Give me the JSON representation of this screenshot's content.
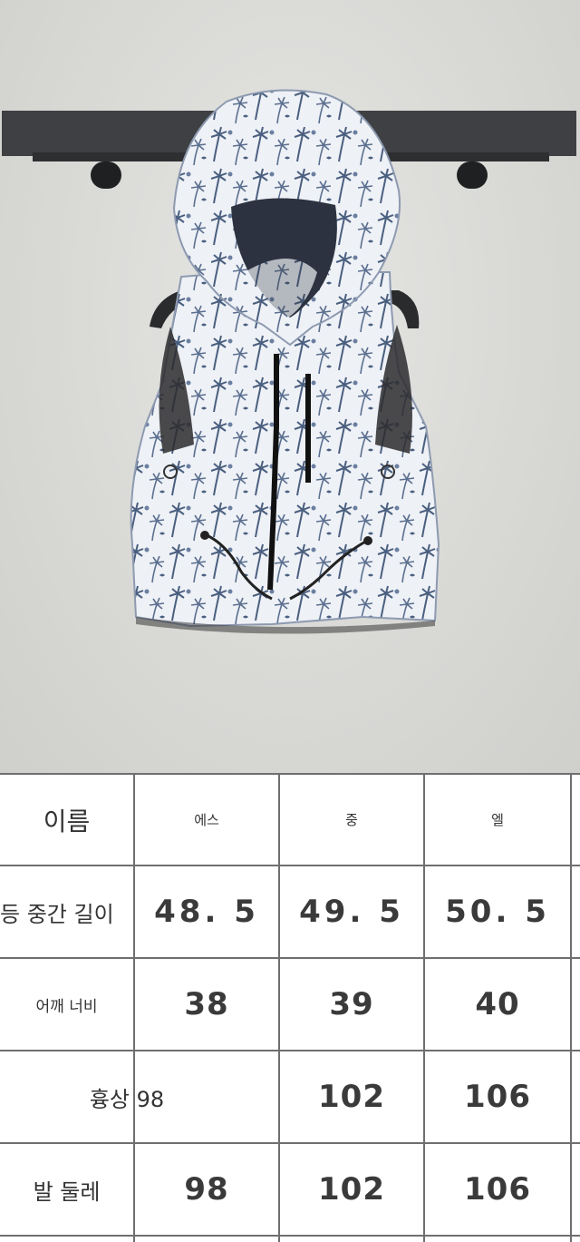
{
  "table": {
    "header": {
      "label": "이름",
      "sizes": [
        "에스",
        "중",
        "엘"
      ]
    },
    "rows": [
      {
        "label": "등 중간 길이",
        "values": [
          "48. 5",
          "49. 5",
          "50. 5"
        ]
      },
      {
        "label": "어깨 너비",
        "values": [
          "38",
          "39",
          "40"
        ]
      },
      {
        "label": "흉상 98",
        "values": [
          "",
          "102",
          "106"
        ]
      },
      {
        "label": "발 둘레",
        "values": [
          "98",
          "102",
          "106"
        ]
      }
    ]
  },
  "colors": {
    "grid": "#6f6f6f",
    "text": "#333333",
    "print": "#4a5f7f",
    "wall": "#d9d9d6"
  },
  "photo": {
    "subject": "hooded-vest-photo"
  }
}
